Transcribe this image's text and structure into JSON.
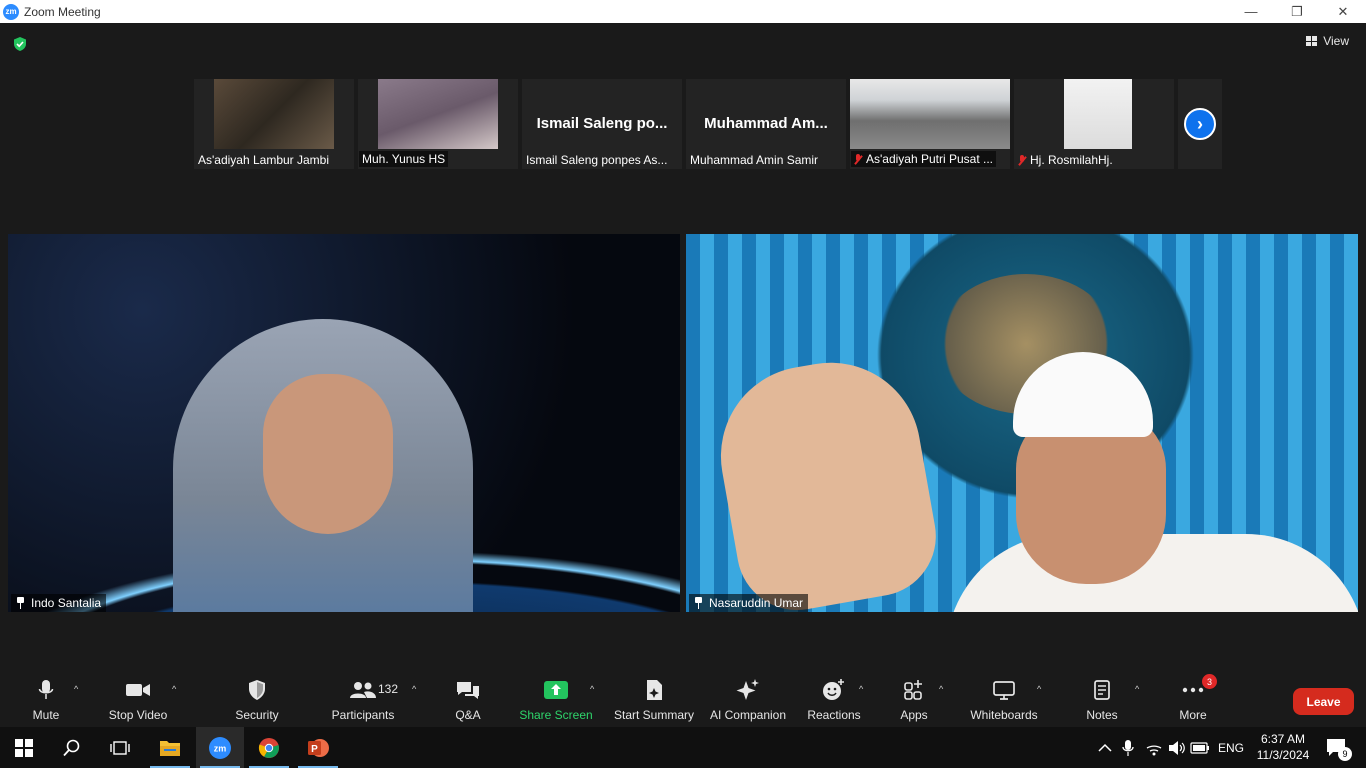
{
  "window": {
    "title": "Zoom Meeting",
    "app_icon_text": "zm",
    "minimize": "—",
    "maximize": "❐",
    "close": "✕"
  },
  "header": {
    "view_label": "View"
  },
  "filmstrip": {
    "tiles": [
      {
        "label": "As'adiyah Lambur Jambi",
        "muted": false
      },
      {
        "label": "Muh. Yunus HS",
        "muted": false
      },
      {
        "big_name": "Ismail Saleng po...",
        "label": "Ismail Saleng ponpes As...",
        "muted": false
      },
      {
        "big_name": "Muhammad Am...",
        "label": "Muhammad Amin Samir",
        "muted": false
      },
      {
        "label": "As'adiyah Putri Pusat ...",
        "muted": true
      },
      {
        "label": "Hj. RosmilahHj.",
        "muted": true
      }
    ],
    "next_icon": "›"
  },
  "videos": [
    {
      "name": "Indo Santalia"
    },
    {
      "name": "Nasaruddin Umar"
    }
  ],
  "toolbar": {
    "mute": "Mute",
    "stop_video": "Stop Video",
    "security": "Security",
    "participants": "Participants",
    "participant_count": "132",
    "qa": "Q&A",
    "share_screen": "Share Screen",
    "start_summary": "Start Summary",
    "ai_companion": "AI Companion",
    "reactions": "Reactions",
    "apps": "Apps",
    "whiteboards": "Whiteboards",
    "notes": "Notes",
    "more": "More",
    "more_badge": "3",
    "leave": "Leave",
    "caret": "^"
  },
  "taskbar": {
    "lang": "ENG",
    "time": "6:37 AM",
    "date": "11/3/2024",
    "notif_count": "9"
  },
  "colors": {
    "accent": "#0e72ed",
    "share_green": "#2ed46b",
    "leave_red": "#d52b1e"
  }
}
